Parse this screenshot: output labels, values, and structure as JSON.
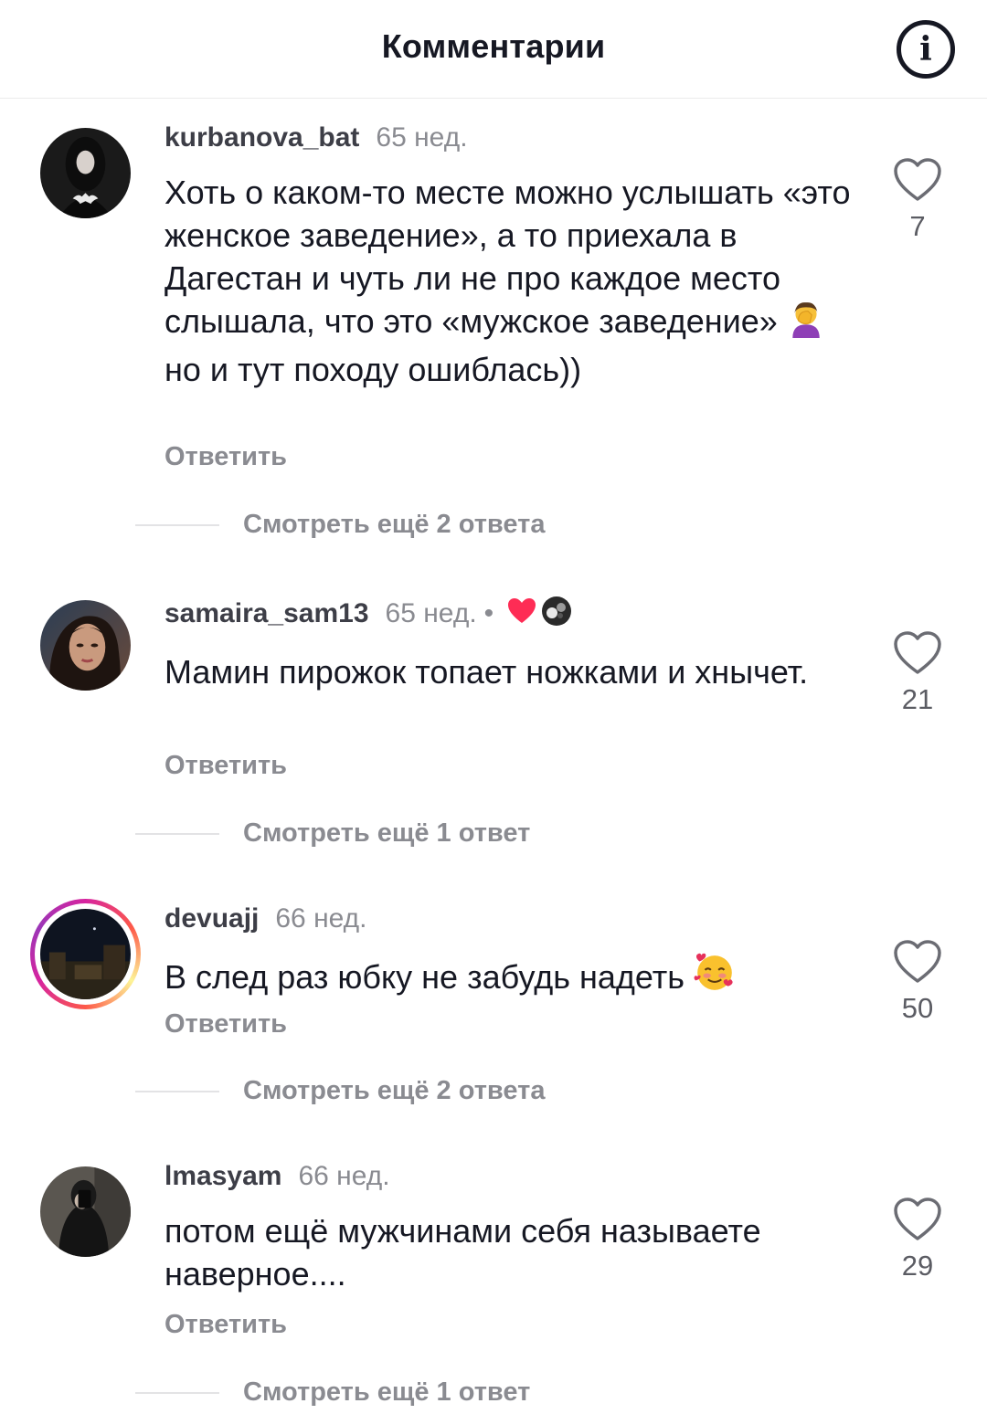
{
  "header": {
    "title": "Комментарии",
    "info_icon": "info-icon"
  },
  "comments": [
    {
      "username": "kurbanova_bat",
      "time": "65 нед.",
      "text_parts": [
        "Хоть о каком-то месте можно услышать «это женское заведение», а то приехала в Дагестан и чуть ли не про каждое место слышала, что это «мужское заведение» ",
        " но и тут походу ошиблась))"
      ],
      "emoji": "facepalm-woman-emoji",
      "reply": "Ответить",
      "likes": "7",
      "more_replies": "Смотреть ещё 2 ответа"
    },
    {
      "username": "samaira_sam13",
      "time": "65 нед.",
      "dot": "•",
      "reactions": [
        "heart-reaction-icon",
        "creator-avatar-icon"
      ],
      "text": "Мамин пирожок топает ножками и хнычет.",
      "reply": "Ответить",
      "likes": "21",
      "more_replies": "Смотреть ещё 1 ответ"
    },
    {
      "username": "devuajj",
      "time": "66 нед.",
      "has_story": true,
      "text": "В след раз юбку не забудь надеть",
      "emoji": "smiling-face-with-hearts-emoji",
      "reply": "Ответить",
      "likes": "50",
      "more_replies": "Смотреть ещё 2 ответа"
    },
    {
      "username": "lmasyam",
      "time": "66 нед.",
      "text": "потом ещё мужчинами себя называете наверное....",
      "reply": "Ответить",
      "likes": "29",
      "more_replies": "Смотреть ещё 1 ответ"
    }
  ],
  "colors": {
    "text": "#161823",
    "secondary": "#8a8b91",
    "reaction_heart": "#fe2c55"
  }
}
